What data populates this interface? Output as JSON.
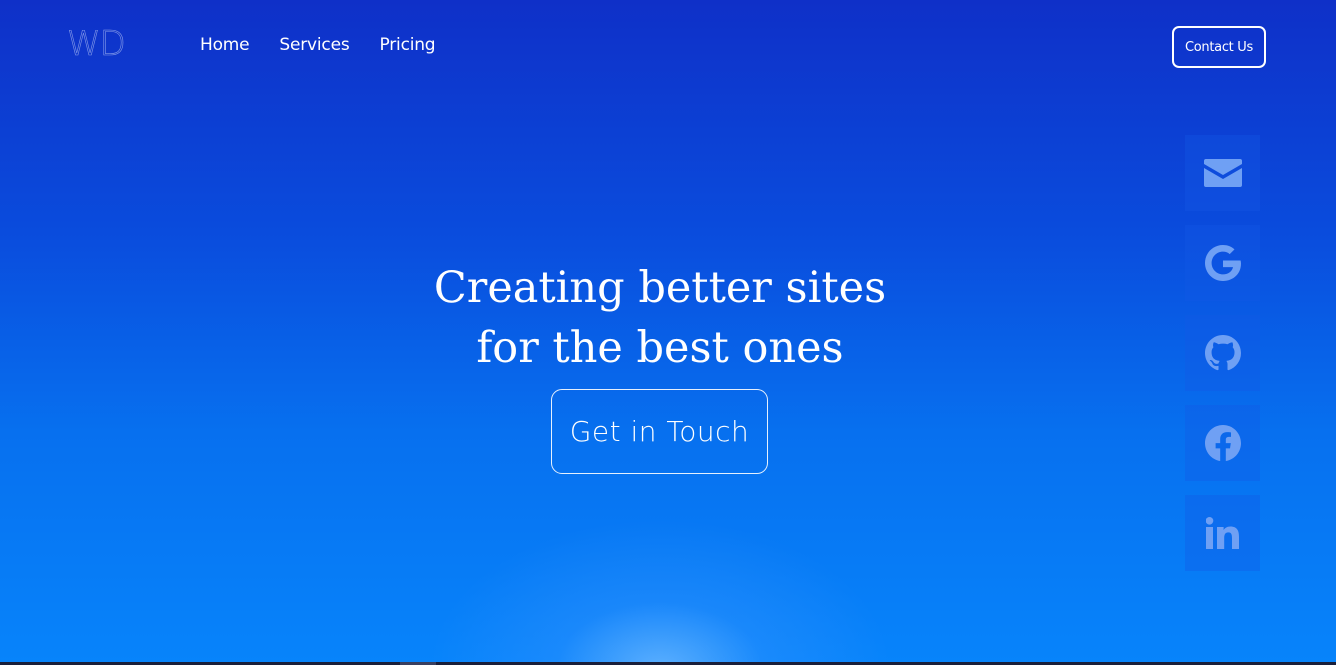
{
  "header": {
    "logo": "WD",
    "nav": [
      "Home",
      "Services",
      "Pricing"
    ],
    "contact_label": "Contact Us"
  },
  "hero": {
    "title_line1": "Creating better sites",
    "title_line2": "for the best ones",
    "cta_label": "Get in Touch"
  },
  "social": [
    {
      "icon": "envelope-icon"
    },
    {
      "icon": "google-icon"
    },
    {
      "icon": "github-icon"
    },
    {
      "icon": "facebook-icon"
    },
    {
      "icon": "linkedin-icon"
    }
  ],
  "colors": {
    "background_top": "#0f30c8",
    "background_bottom": "#0784fb",
    "icon": "#6fa0f4",
    "text": "#ffffff"
  }
}
